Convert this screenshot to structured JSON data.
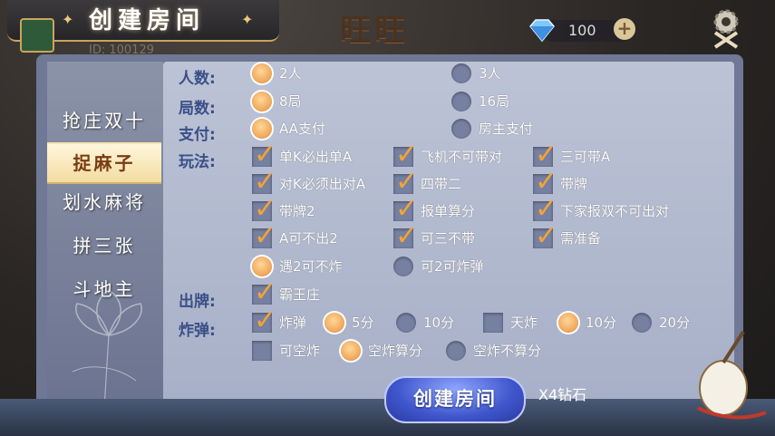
{
  "header": {
    "title": "创建房间",
    "user_id": "ID: 100129",
    "logo_text": "旺旺",
    "diamonds": "100",
    "plus_label": "+"
  },
  "sidebar": {
    "items": [
      {
        "label": "抢庄双十",
        "active": false
      },
      {
        "label": "捉麻子",
        "active": true
      },
      {
        "label": "划水麻将",
        "active": false
      },
      {
        "label": "拼三张",
        "active": false
      },
      {
        "label": "斗地主",
        "active": false
      }
    ]
  },
  "form": {
    "players": {
      "label": "人数:",
      "options": [
        {
          "text": "2人",
          "on": true
        },
        {
          "text": "3人",
          "on": false
        }
      ]
    },
    "rounds": {
      "label": "局数:",
      "options": [
        {
          "text": "8局",
          "on": true
        },
        {
          "text": "16局",
          "on": false
        }
      ]
    },
    "payment": {
      "label": "支付:",
      "options": [
        {
          "text": "AA支付",
          "on": true
        },
        {
          "text": "房主支付",
          "on": false
        }
      ]
    },
    "play": {
      "label": "玩法:",
      "checks": [
        {
          "text": "单K必出单A",
          "on": true
        },
        {
          "text": "飞机不可带对",
          "on": true
        },
        {
          "text": "三可带A",
          "on": true
        },
        {
          "text": "对K必须出对A",
          "on": true
        },
        {
          "text": "四带二",
          "on": true
        },
        {
          "text": "带牌",
          "on": true
        },
        {
          "text": "带牌2",
          "on": true
        },
        {
          "text": "报单算分",
          "on": true
        },
        {
          "text": "下家报双不可出对",
          "on": true
        },
        {
          "text": "A可不出2",
          "on": true
        },
        {
          "text": "可三不带",
          "on": true
        },
        {
          "text": "需准备",
          "on": true
        }
      ],
      "radios": [
        {
          "text": "遇2可不炸",
          "on": true
        },
        {
          "text": "可2可炸弹",
          "on": false
        }
      ]
    },
    "deal": {
      "label": "出牌:",
      "check": {
        "text": "霸王庄",
        "on": true
      }
    },
    "bomb": {
      "label": "炸弹:",
      "bomb_check": {
        "text": "炸弹",
        "on": true
      },
      "bomb_5": {
        "text": "5分",
        "on": true
      },
      "bomb_10": {
        "text": "10分",
        "on": false
      },
      "tianzha_check": {
        "text": "天炸",
        "on": false
      },
      "tianzha_10": {
        "text": "10分",
        "on": true
      },
      "tianzha_20": {
        "text": "20分",
        "on": false
      },
      "empty_check": {
        "text": "可空炸",
        "on": false
      },
      "empty_score": {
        "text": "空炸算分",
        "on": true
      },
      "empty_noscore": {
        "text": "空炸不算分",
        "on": false
      }
    }
  },
  "footer": {
    "create_label": "创建房间",
    "cost": "X4钻石"
  },
  "colors": {
    "accent": "#f3a337",
    "label": "#3a4f86",
    "button": "#3f56cc"
  },
  "icons": {
    "diamond": "diamond-icon",
    "settings": "gear-icon",
    "instrument": "pipa-icon"
  }
}
